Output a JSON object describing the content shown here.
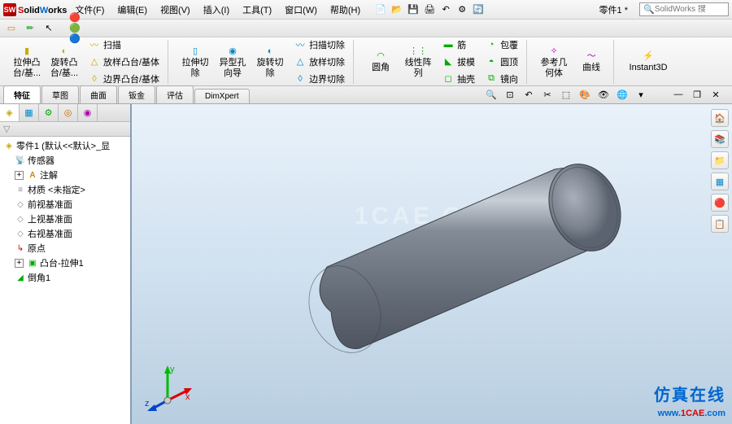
{
  "app": {
    "name_s": "S",
    "name_olid": "olid",
    "name_w": "W",
    "name_orks": "orks"
  },
  "menu": [
    "文件(F)",
    "编辑(E)",
    "视图(V)",
    "插入(I)",
    "工具(T)",
    "窗口(W)",
    "帮助(H)"
  ],
  "doc_title": "零件1 *",
  "search_placeholder": "SolidWorks 搜",
  "ribbon": {
    "g1": {
      "big1": "拉伸凸\n台/基...",
      "big2": "旋转凸\n台/基...",
      "s1": "扫描",
      "s2": "放样凸台/基体",
      "s3": "边界凸台/基体"
    },
    "g2": {
      "big1": "拉伸切\n除",
      "big2": "异型孔\n向导",
      "big3": "旋转切\n除",
      "s1": "扫描切除",
      "s2": "放样切除",
      "s3": "边界切除"
    },
    "g3": {
      "big1": "圆角",
      "big2": "线性阵\n列",
      "s1": "筋",
      "s2": "拔模",
      "s3": "抽壳",
      "s4": "包覆",
      "s5": "圆顶",
      "s6": "镜向"
    },
    "g4": {
      "big1": "参考几\n何体",
      "big2": "曲线"
    },
    "g5": {
      "big": "Instant3D"
    }
  },
  "tabs": [
    "特征",
    "草图",
    "曲面",
    "钣金",
    "评估",
    "DimXpert"
  ],
  "tree": {
    "root": "零件1 (默认<<默认>_显",
    "items": [
      "传感器",
      "注解",
      "材质 <未指定>",
      "前视基准面",
      "上视基准面",
      "右视基准面",
      "原点",
      "凸台-拉伸1",
      "倒角1"
    ]
  },
  "watermark": "1CAE.COM",
  "badge": {
    "line1": "仿真在线",
    "www": "www.",
    "domain": "1CAE",
    "com": ".com"
  },
  "icons": {
    "new": "📄",
    "open": "📂",
    "save": "💾",
    "print": "🖨",
    "undo": "↶",
    "redo": "↷",
    "options": "⚙",
    "rebuild": "🔄",
    "select": "▭",
    "zoom": "🔍",
    "pan": "✋",
    "rotate": "🔄",
    "section": "✂",
    "display": "🎨",
    "scene": "🌐",
    "extrude": "▮",
    "revolve": "◐",
    "sweep": "〰",
    "loft": "△",
    "cut": "▯",
    "hole": "◉",
    "fillet": "◠",
    "pattern": "⋮⋮",
    "rib": "▬",
    "draft": "◣",
    "shell": "◻",
    "wrap": "◔",
    "dome": "◓",
    "mirror": "⧉",
    "ref": "✧",
    "curve": "〜",
    "i3d": "⚡",
    "sensor": "📡",
    "annot": "A",
    "material": "≡",
    "plane": "◇",
    "origin": "↳",
    "feature": "▣",
    "chamfer": "◢",
    "assy": "🔧",
    "part": "📦",
    "home": "🏠",
    "folder": "📁",
    "star": "⭐"
  }
}
